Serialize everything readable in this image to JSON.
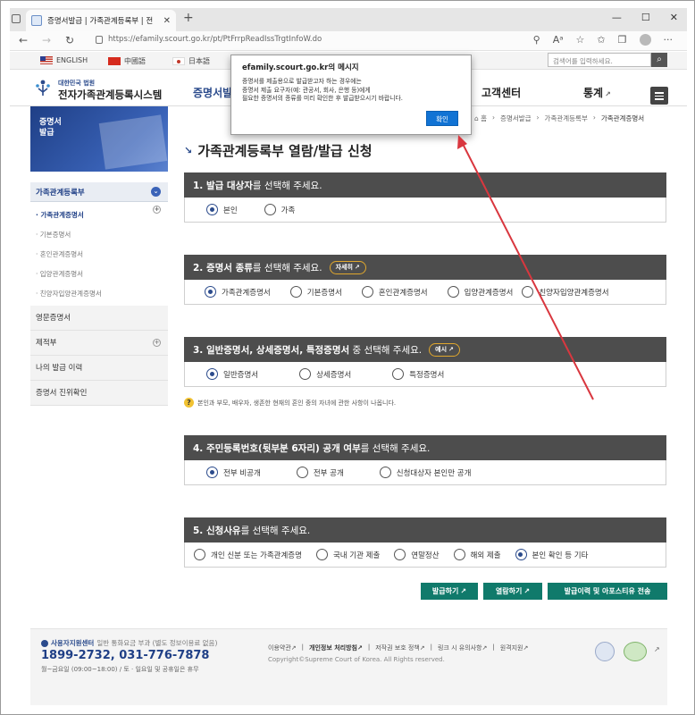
{
  "browser": {
    "tab_title": "증명서발급 | 가족관계등록부 | 전",
    "tab_close": "✕",
    "new_tab": "+",
    "url": "https://efamily.scourt.go.kr/pt/PtFrrpReadIssTrgtInfoW.do",
    "window_controls": [
      "—",
      "☐",
      "✕"
    ]
  },
  "site": {
    "languages": [
      {
        "label": "ENGLISH",
        "flag": "us"
      },
      {
        "label": "中國語",
        "flag": "cn"
      },
      {
        "label": "日本語",
        "flag": "jp"
      }
    ],
    "search_placeholder": "검색어를 입력하세요.",
    "logo_small": "대한민국 법원",
    "logo_title": "전자가족관계등록시스템",
    "gnb": [
      "증명서발",
      "고객센터",
      "통계"
    ],
    "visual_text": "증명서\n발급"
  },
  "sidebar": {
    "head": "가족관계등록부",
    "sub": [
      "· 가족관계증명서",
      "· 기본증명서",
      "· 혼인관계증명서",
      "· 입양관계증명서",
      "· 친양자입양관계증명서"
    ],
    "menus": [
      "영문증명서",
      "제적부",
      "나의 발급 이력",
      "증명서 진위확인"
    ]
  },
  "breadcrumb": [
    "⌂ 홈",
    "›",
    "증명서발급",
    "›",
    "가족관계등록부",
    "›",
    "가족관계증명서"
  ],
  "page_title": "가족관계등록부 열람/발급 신청",
  "sections": [
    {
      "num": "1.",
      "title": "발급 대상자",
      "rest": "를 선택해 주세요.",
      "options": [
        "본인",
        "가족"
      ],
      "selected": 0
    },
    {
      "num": "2.",
      "title": "증명서 종류",
      "rest": "를 선택해 주세요.",
      "button": "자세히",
      "options": [
        "가족관계증명서",
        "기본증명서",
        "혼인관계증명서",
        "입양관계증명서",
        "친양자입양관계증명서"
      ],
      "selected": 0
    },
    {
      "num": "3.",
      "title": "일반증명서, 상세증명서, 특정증명서",
      "rest": " 중 선택해 주세요.",
      "button": "예시",
      "options": [
        "일반증명서",
        "상세증명서",
        "특정증명서"
      ],
      "selected": 0
    },
    {
      "num": "4.",
      "title": "주민등록번호(뒷부분 6자리) 공개 여부",
      "rest": "를 선택해 주세요.",
      "options": [
        "전부 비공개",
        "전부 공개",
        "신청대상자 본인만 공개"
      ],
      "selected": 0
    },
    {
      "num": "5.",
      "title": "신청사유",
      "rest": "를 선택해 주세요.",
      "options": [
        "개인 신분 또는 가족관계증명",
        "국내 기관 제출",
        "연말정산",
        "해외 제출",
        "본인 확인 등 기타"
      ],
      "selected": 4
    }
  ],
  "note": "본인과 부모, 배우자, 생존한 현재의 혼인 중의 자녀에 관한 사항이 나옵니다.",
  "actions": [
    "발급하기",
    "열람하기",
    "발급이력 및 아포스티유 전송"
  ],
  "footer": {
    "cs_title": "사용자지원센터",
    "cs_sub": "일반 통화요금 부과 (별도 정보이용료 없음)",
    "phone": "1899-2732, 031-776-7878",
    "hours": "월~금요일 (09:00~18:00) / 토 · 일요일 및 공휴일은 휴무",
    "links": [
      "이용약관",
      "개인정보 처리방침",
      "저작권 보호 정책",
      "링크 시 유의사항",
      "원격지원"
    ],
    "copyright": "Copyright©Supreme Court of Korea. All Rights reserved."
  },
  "dialog": {
    "host": "efamily.scourt.go.kr의 메시지",
    "message": "증명서를 제출용으로 발급받고자 하는 경우에는\n증명서 제출 요구자(예: 관공서, 회사, 은행 등)에게\n필요한 증명서의 종류를 미리 확인한 후 발급받으시기 바랍니다.",
    "ok": "확인"
  },
  "colors": {
    "accent": "#2b4b8c",
    "section_head": "#4d4d4d",
    "action_button": "#107a6b",
    "dialog_ok": "#1173d4",
    "annotation_arrow": "#d9373f"
  }
}
